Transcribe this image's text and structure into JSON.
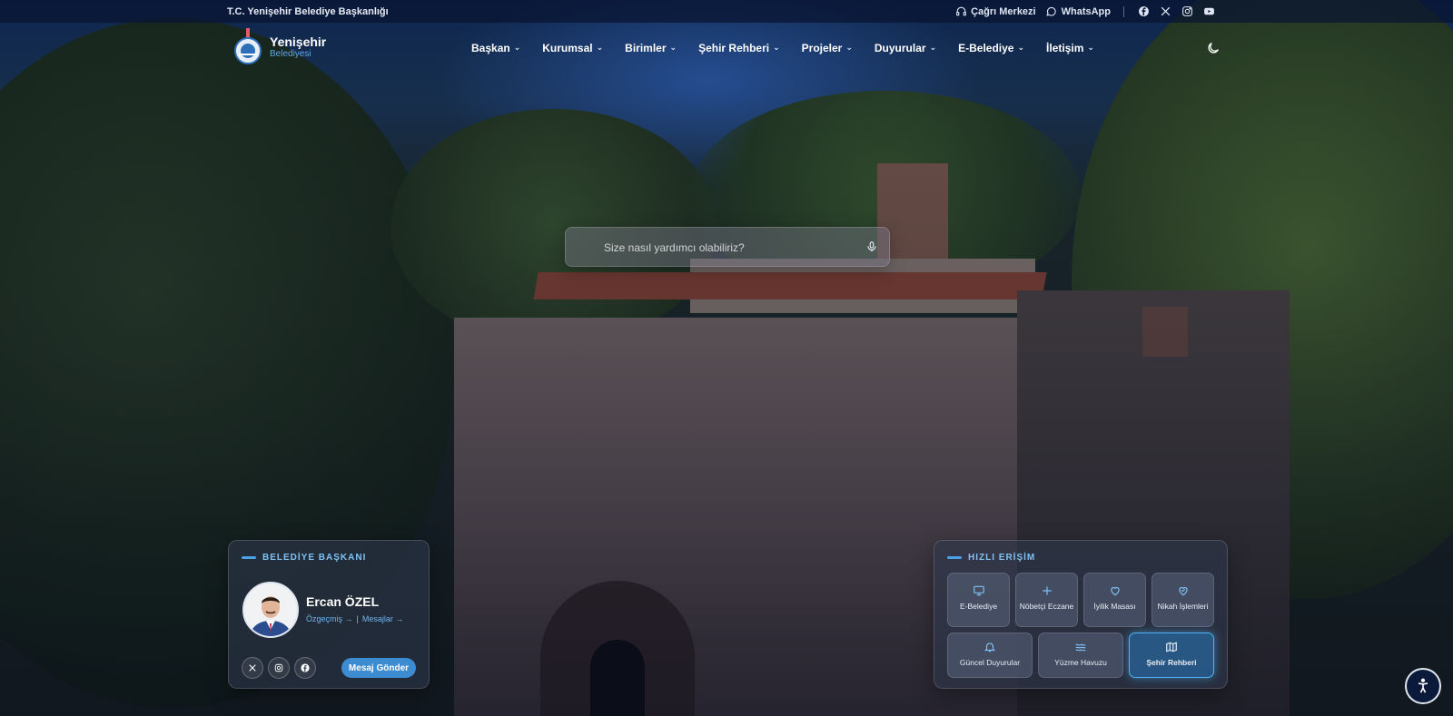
{
  "topbar": {
    "org_name": "T.C. Yenişehir Belediye Başkanlığı",
    "call_center": "Çağrı Merkezi",
    "whatsapp": "WhatsApp",
    "social_icons": [
      "facebook-icon",
      "x-icon",
      "instagram-icon",
      "youtube-icon"
    ]
  },
  "header": {
    "logo_name": "Yenişehir",
    "logo_sub": "Belediyesi",
    "nav": [
      "Başkan",
      "Kurumsal",
      "Birimler",
      "Şehir Rehberi",
      "Projeler",
      "Duyurular",
      "E-Belediye",
      "İletişim"
    ],
    "theme_icon": "moon-icon"
  },
  "search": {
    "placeholder": "Size nasıl yardımcı olabiliriz?",
    "value": ""
  },
  "mayor_panel": {
    "title": "BELEDİYE BAŞKANI",
    "name": "Ercan ÖZEL",
    "link_bio": "Özgeçmiş →",
    "link_sep": "|",
    "link_messages": "Mesajlar →",
    "send_button": "Mesaj Gönder"
  },
  "quick_access": {
    "title": "HIZLI ERİŞİM",
    "items": [
      {
        "label": "E-Belediye",
        "icon": "monitor-icon"
      },
      {
        "label": "Nöbetçi Eczane",
        "icon": "plus-icon"
      },
      {
        "label": "İyilik Masası",
        "icon": "heart-icon"
      },
      {
        "label": "Nikah İşlemleri",
        "icon": "rings-heart-icon"
      },
      {
        "label": "Güncel Duyurular",
        "icon": "bell-icon"
      },
      {
        "label": "Yüzme Havuzu",
        "icon": "waves-icon"
      },
      {
        "label": "Şehir Rehberi",
        "icon": "map-icon"
      }
    ]
  },
  "colors": {
    "accent": "#4aa3e8",
    "button": "#3d8bd0",
    "topbar": "#081430"
  }
}
